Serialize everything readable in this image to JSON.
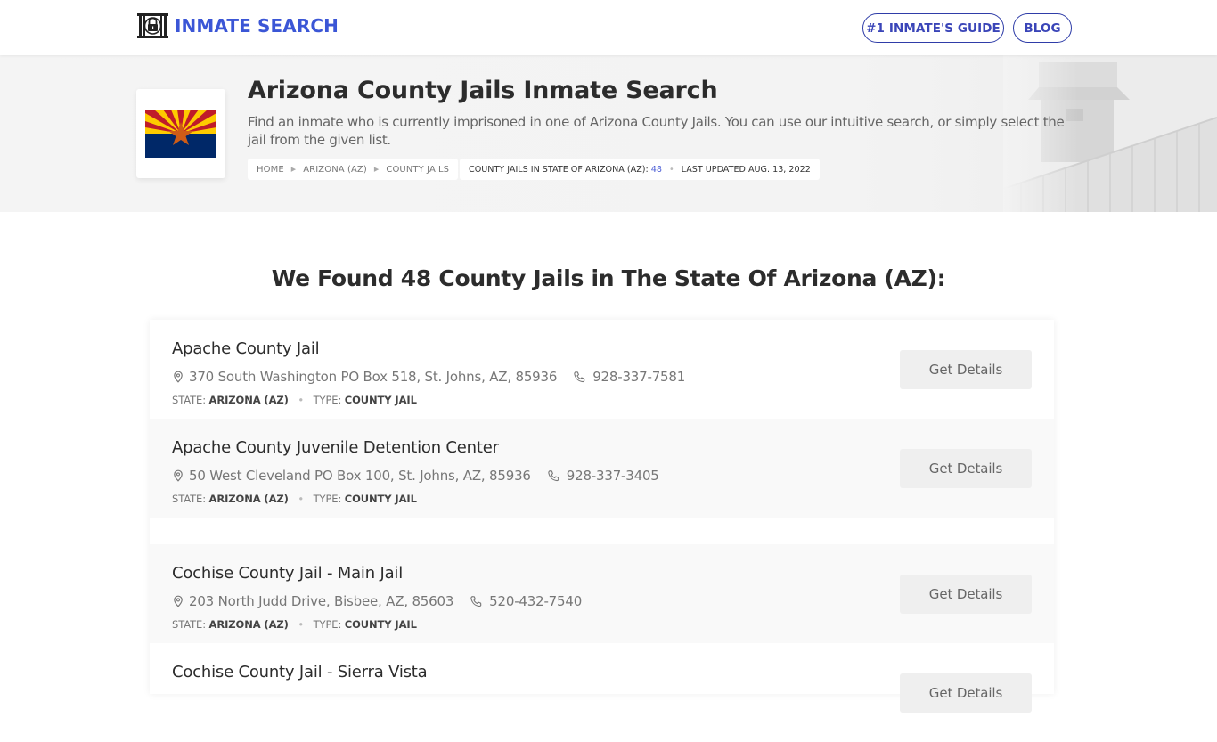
{
  "header": {
    "logo_text": "INMATE SEARCH",
    "logo_icon": "jail-lock-icon",
    "nav": [
      {
        "label": "#1 INMATE'S GUIDE"
      },
      {
        "label": "BLOG"
      }
    ],
    "brand_color": "#3b56d6"
  },
  "hero": {
    "title": "Arizona County Jails Inmate Search",
    "description": "Find an inmate who is currently imprisoned in one of Arizona County Jails. You can use our intuitive search, or simply select the jail from the given list.",
    "flag_icon": "arizona-flag-icon",
    "breadcrumb": [
      {
        "label": "HOME"
      },
      {
        "label": "ARIZONA (AZ)"
      },
      {
        "label": "COUNTY JAILS"
      }
    ],
    "stats": {
      "count_label": "COUNTY JAILS IN STATE OF ARIZONA (AZ):",
      "count": "48",
      "updated": "LAST UPDATED AUG. 13, 2022"
    }
  },
  "main": {
    "heading": "We Found 48 County Jails in The State Of Arizona (AZ):",
    "state_label": "STATE:",
    "type_label": "TYPE:",
    "button_label": "Get Details",
    "jails": [
      {
        "name": "Apache County Jail",
        "address": "370 South Washington PO Box 518, St. Johns, AZ, 85936",
        "phone": "928-337-7581",
        "state": "ARIZONA (AZ)",
        "type": "COUNTY JAIL"
      },
      {
        "name": "Apache County Juvenile Detention Center",
        "address": "50 West Cleveland PO Box 100, St. Johns, AZ, 85936",
        "phone": "928-337-3405",
        "state": "ARIZONA (AZ)",
        "type": "COUNTY JAIL"
      },
      {
        "name": "Cochise County Jail - Main Jail",
        "address": "203 North Judd Drive, Bisbee, AZ, 85603",
        "phone": "520-432-7540",
        "state": "ARIZONA (AZ)",
        "type": "COUNTY JAIL"
      },
      {
        "name": "Cochise County Jail - Sierra Vista",
        "address": "",
        "phone": "",
        "state": "",
        "type": ""
      }
    ]
  }
}
